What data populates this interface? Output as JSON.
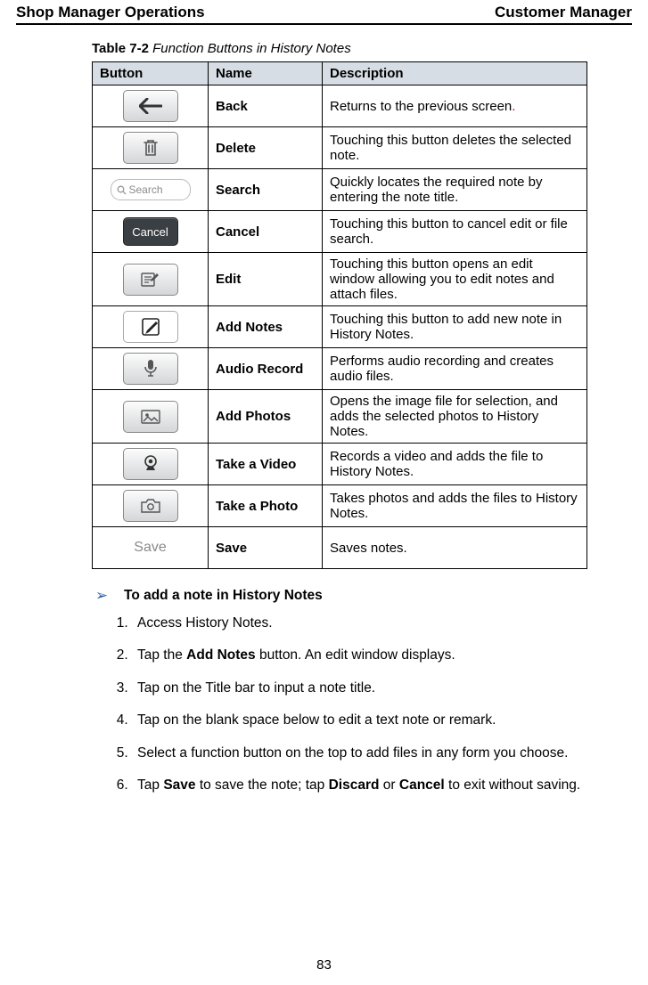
{
  "header": {
    "left": "Shop Manager Operations",
    "right": "Customer Manager"
  },
  "caption": {
    "label": "Table 7-2",
    "title": "Function Buttons in History Notes"
  },
  "columns": {
    "c1": "Button",
    "c2": "Name",
    "c3": "Description"
  },
  "rows": {
    "back": {
      "name": "Back",
      "desc_pre": "Returns to the previous screen",
      "dot": "."
    },
    "delete": {
      "name": "Delete",
      "desc": "Touching this button deletes the selected note."
    },
    "search": {
      "name": "Search",
      "desc": "Quickly locates the required note by entering the note title.",
      "placeholder": "Search"
    },
    "cancel": {
      "name": "Cancel",
      "desc": "Touching this button to cancel edit or file search.",
      "label": "Cancel"
    },
    "edit": {
      "name": "Edit",
      "desc": "Touching this button opens an edit window allowing you to edit notes and attach files."
    },
    "addnote": {
      "name": "Add Notes",
      "desc": "Touching this button to add new note in History Notes."
    },
    "audio": {
      "name": "Audio Record",
      "desc": "Performs audio recording and creates audio files."
    },
    "photos": {
      "name": "Add Photos",
      "desc": "Opens the image file for selection, and adds the selected photos to History Notes."
    },
    "video": {
      "name": "Take a Video",
      "desc": "Records a video and adds the file to History Notes."
    },
    "photo": {
      "name": "Take a Photo",
      "desc": "Takes photos and adds the files to History Notes."
    },
    "save": {
      "name": "Save",
      "desc": "Saves notes.",
      "label": "Save"
    }
  },
  "procedure": {
    "title": "To add a note in History Notes",
    "steps": {
      "s1": "Access History Notes.",
      "s2_a": "Tap the ",
      "s2_b": "Add Notes",
      "s2_c": " button. An edit window displays.",
      "s3": "Tap on the Title bar to input a note title.",
      "s4": "Tap on the blank space below to edit a text note or remark.",
      "s5": "Select a function button on the top to add files in any form you choose.",
      "s6_a": "Tap ",
      "s6_b": "Save",
      "s6_c": " to save the note; tap ",
      "s6_d": "Discard",
      "s6_e": " or ",
      "s6_f": "Cancel",
      "s6_g": " to exit without saving."
    }
  },
  "page_number": "83"
}
